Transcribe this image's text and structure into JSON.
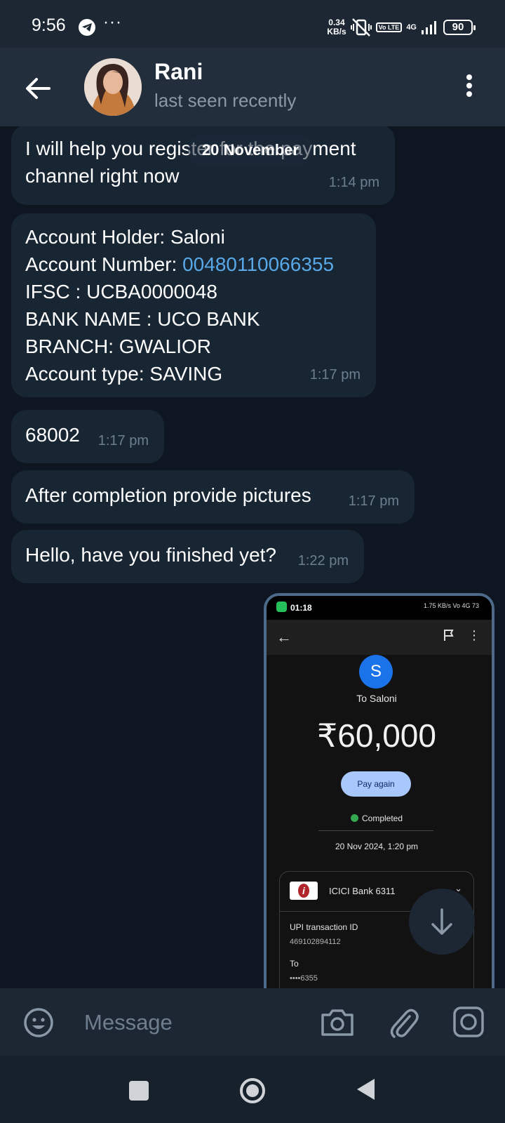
{
  "status_bar": {
    "time": "9:56",
    "more": "···",
    "net_speed_value": "0.34",
    "net_speed_unit": "KB/s",
    "volte": "Vo LTE",
    "network": "4G",
    "battery": "90"
  },
  "header": {
    "name": "Rani",
    "status": "last seen recently"
  },
  "date_chip": "20 November",
  "messages": [
    {
      "lines": [
        "I will help you register for the payment",
        "channel right now"
      ],
      "time": "1:14 pm"
    },
    {
      "holder": "Account Holder: Saloni",
      "number_label": "Account Number: ",
      "number_value": "00480110066355",
      "ifsc": "IFSC : UCBA0000048",
      "bank": "BANK NAME : UCO BANK",
      "branch": "BRANCH: GWALIOR",
      "type": "Account type: SAVING",
      "time": "1:17 pm"
    },
    {
      "text": "68002",
      "time": "1:17 pm"
    },
    {
      "text": "After completion provide pictures",
      "time": "1:17 pm"
    },
    {
      "text": "Hello, have you finished yet?",
      "time": "1:22 pm"
    }
  ],
  "screenshot": {
    "time": "01:18",
    "status_icons": "1.75 KB/s  Vo 4G  73",
    "avatar_letter": "S",
    "to": "To Saloni",
    "amount": "₹60,000",
    "pay_again": "Pay again",
    "completed": "Completed",
    "date": "20 Nov 2024, 1:20 pm",
    "bank": "ICICI Bank 6311",
    "upi_label": "UPI transaction ID",
    "upi_value": "469102894112",
    "to_label": "To",
    "to_value": "••••6355"
  },
  "input": {
    "placeholder": "Message"
  }
}
